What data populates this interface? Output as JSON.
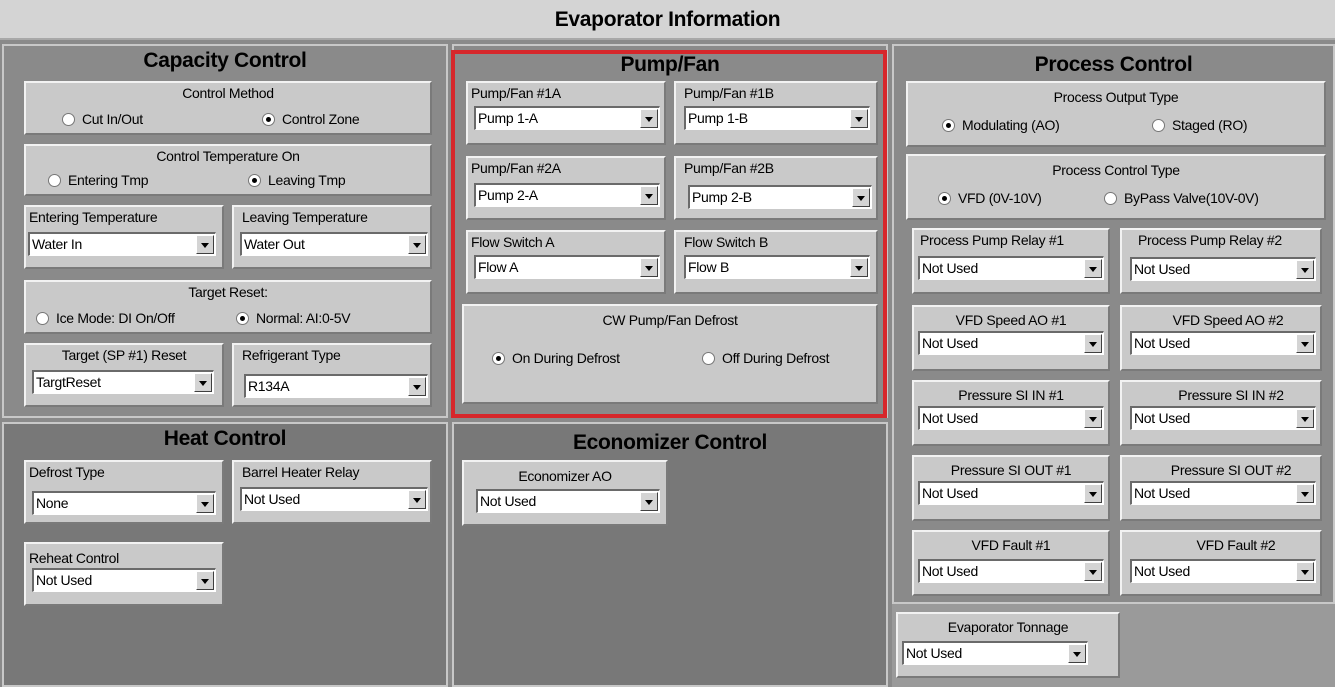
{
  "title": "Evaporator Information",
  "capacity": {
    "title": "Capacity Control",
    "control_method": {
      "label": "Control Method",
      "opt1": "Cut In/Out",
      "opt2": "Control Zone"
    },
    "control_temp": {
      "label": "Control Temperature On",
      "opt1": "Entering Tmp",
      "opt2": "Leaving Tmp"
    },
    "entering_temp": {
      "label": "Entering Temperature",
      "value": "Water In"
    },
    "leaving_temp": {
      "label": "Leaving Temperature",
      "value": "Water Out"
    },
    "target_reset": {
      "label": "Target Reset:",
      "opt1": "Ice Mode: DI On/Off",
      "opt2": "Normal: AI:0-5V"
    },
    "target_sp": {
      "label": "Target (SP #1) Reset",
      "value": "TargtReset"
    },
    "refrigerant": {
      "label": "Refrigerant Type",
      "value": "R134A"
    }
  },
  "pump": {
    "title": "Pump/Fan",
    "p1a": {
      "label": "Pump/Fan #1A",
      "value": "Pump 1-A"
    },
    "p1b": {
      "label": "Pump/Fan #1B",
      "value": "Pump 1-B"
    },
    "p2a": {
      "label": "Pump/Fan #2A",
      "value": "Pump 2-A"
    },
    "p2b": {
      "label": "Pump/Fan #2B",
      "value": "Pump 2-B"
    },
    "flow_a": {
      "label": "Flow Switch A",
      "value": "Flow A"
    },
    "flow_b": {
      "label": "Flow Switch B",
      "value": "Flow B"
    },
    "defrost": {
      "label": "CW Pump/Fan Defrost",
      "opt1": "On During Defrost",
      "opt2": "Off During Defrost"
    }
  },
  "process": {
    "title": "Process Control",
    "output_type": {
      "label": "Process Output Type",
      "opt1": "Modulating (AO)",
      "opt2": "Staged (RO)"
    },
    "control_type": {
      "label": "Process Control Type",
      "opt1": "VFD (0V-10V)",
      "opt2": "ByPass Valve(10V-0V)"
    },
    "ppr1": {
      "label": "Process Pump Relay #1",
      "value": "Not Used"
    },
    "ppr2": {
      "label": "Process Pump Relay #2",
      "value": "Not Used"
    },
    "vfd1": {
      "label": "VFD Speed AO #1",
      "value": "Not Used"
    },
    "vfd2": {
      "label": "VFD Speed AO #2",
      "value": "Not Used"
    },
    "psin1": {
      "label": "Pressure SI IN #1",
      "value": "Not Used"
    },
    "psin2": {
      "label": "Pressure SI IN #2",
      "value": "Not Used"
    },
    "psout1": {
      "label": "Pressure SI OUT #1",
      "value": "Not Used"
    },
    "psout2": {
      "label": "Pressure SI OUT #2",
      "value": "Not Used"
    },
    "fault1": {
      "label": "VFD Fault #1",
      "value": "Not Used"
    },
    "fault2": {
      "label": "VFD Fault #2",
      "value": "Not Used"
    }
  },
  "tonnage": {
    "label": "Evaporator Tonnage",
    "value": "Not Used"
  },
  "heat": {
    "title": "Heat Control",
    "defrost_type": {
      "label": "Defrost Type",
      "value": "None"
    },
    "barrel": {
      "label": "Barrel Heater Relay",
      "value": "Not Used"
    },
    "reheat": {
      "label": "Reheat Control",
      "value": "Not Used"
    }
  },
  "economizer": {
    "title": "Economizer Control",
    "ao": {
      "label": "Economizer AO",
      "value": "Not Used"
    }
  },
  "colors": {
    "highlight": "#d6272b",
    "panel": "#787878",
    "groupbox": "#c9c9c9"
  }
}
